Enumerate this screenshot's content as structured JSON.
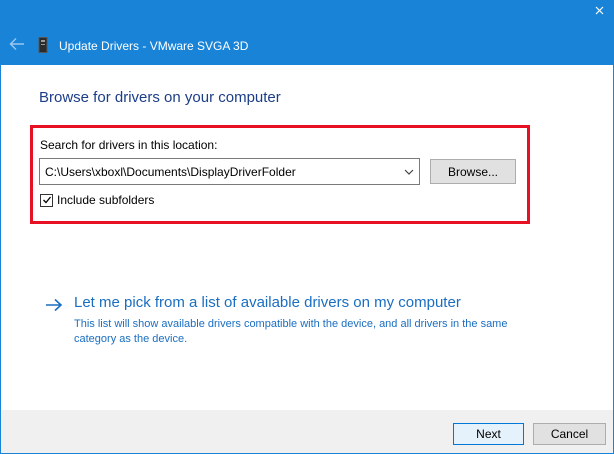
{
  "window": {
    "title": "Update Drivers - VMware SVGA 3D",
    "back_icon": "arrow-left-icon",
    "device_icon": "graphics-card-icon",
    "close_icon": "close-icon"
  },
  "main": {
    "heading": "Browse for drivers on your computer",
    "search": {
      "label": "Search for drivers in this location:",
      "path_value": "C:\\Users\\xboxl\\Documents\\DisplayDriverFolder",
      "browse_label": "Browse...",
      "include_subfolders_label": "Include subfolders",
      "include_subfolders_checked": true
    },
    "pick_option": {
      "title": "Let me pick from a list of available drivers on my computer",
      "description": "This list will show available drivers compatible with the device, and all drivers in the same category as the device."
    }
  },
  "footer": {
    "next_label": "Next",
    "cancel_label": "Cancel"
  },
  "colors": {
    "titlebar": "#1883d7",
    "heading": "#1c3d87",
    "link": "#1a6ec2",
    "highlight": "#e81123"
  }
}
